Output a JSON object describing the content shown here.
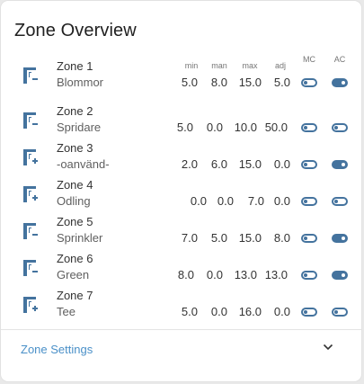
{
  "card": {
    "title": "Zone Overview",
    "columns": {
      "min": "min",
      "man": "man",
      "max": "max",
      "adj": "adj",
      "mc": "MC",
      "ac": "AC"
    },
    "settings_label": "Zone Settings",
    "toggle_color": "#44739e",
    "link_color": "#4a90c8"
  },
  "zones": [
    {
      "name": "Zone 1",
      "desc": "Blommor",
      "icon": "water-minus-icon",
      "min": "5.0",
      "man": "8.0",
      "max": "15.0",
      "adj": "5.0",
      "mc": false,
      "ac": true
    },
    {
      "name": "Zone 2",
      "desc": "Spridare",
      "icon": "water-minus-icon",
      "min": "5.0",
      "man": "0.0",
      "max": "10.0",
      "adj": "50.0",
      "mc": false,
      "ac": false
    },
    {
      "name": "Zone 3",
      "desc": "-oanvänd-",
      "icon": "water-plus-icon",
      "min": "2.0",
      "man": "6.0",
      "max": "15.0",
      "adj": "0.0",
      "mc": false,
      "ac": true
    },
    {
      "name": "Zone 4",
      "desc": "Odling",
      "icon": "water-plus-icon",
      "min": "0.0",
      "man": "0.0",
      "max": "7.0",
      "adj": "0.0",
      "mc": false,
      "ac": false
    },
    {
      "name": "Zone 5",
      "desc": "Sprinkler",
      "icon": "water-minus-icon",
      "min": "7.0",
      "man": "5.0",
      "max": "15.0",
      "adj": "8.0",
      "mc": false,
      "ac": true
    },
    {
      "name": "Zone 6",
      "desc": "Green",
      "icon": "water-minus-icon",
      "min": "8.0",
      "man": "0.0",
      "max": "13.0",
      "adj": "13.0",
      "mc": false,
      "ac": true
    },
    {
      "name": "Zone 7",
      "desc": "Tee",
      "icon": "water-plus-icon",
      "min": "5.0",
      "man": "0.0",
      "max": "16.0",
      "adj": "0.0",
      "mc": false,
      "ac": false
    }
  ]
}
